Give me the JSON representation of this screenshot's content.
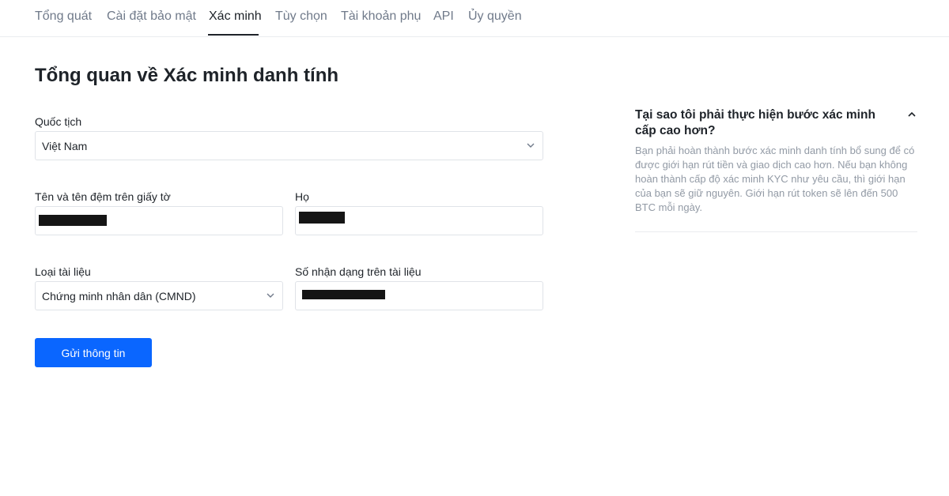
{
  "tabs": [
    {
      "label": "Tổng quát",
      "active": false
    },
    {
      "label": "Cài đặt bảo mật",
      "active": false
    },
    {
      "label": "Xác minh",
      "active": true
    },
    {
      "label": "Tùy chọn",
      "active": false
    },
    {
      "label": "Tài khoản phụ",
      "active": false
    },
    {
      "label": "API",
      "active": false
    },
    {
      "label": "Ủy quyền",
      "active": false
    }
  ],
  "page": {
    "title": "Tổng quan về Xác minh danh tính"
  },
  "form": {
    "nationality": {
      "label": "Quốc tịch",
      "value": "Việt Nam"
    },
    "first_name": {
      "label": "Tên và tên đệm trên giấy tờ",
      "value_redacted": true
    },
    "last_name": {
      "label": "Họ",
      "value_redacted": true
    },
    "document_type": {
      "label": "Loại tài liệu",
      "value": "Chứng minh nhân dân (CMND)"
    },
    "document_number": {
      "label": "Số nhận dạng trên tài liệu",
      "value_redacted": true
    },
    "submit_label": "Gửi thông tin"
  },
  "faq": {
    "question": "Tại sao tôi phải thực hiện bước xác minh cấp cao hơn?",
    "answer": "Bạn phải hoàn thành bước xác minh danh tính bổ sung để có được giới hạn rút tiền và giao dịch cao hơn. Nếu bạn không hoàn thành cấp độ xác minh KYC như yêu cầu, thì giới hạn của bạn sẽ giữ nguyên. Giới hạn rút token sẽ lên đến 500 BTC mỗi ngày.",
    "expanded": true
  },
  "colors": {
    "accent": "#0a66ff",
    "text": "#1e2329",
    "muted": "#707a8a",
    "border": "#e0e3e8"
  }
}
